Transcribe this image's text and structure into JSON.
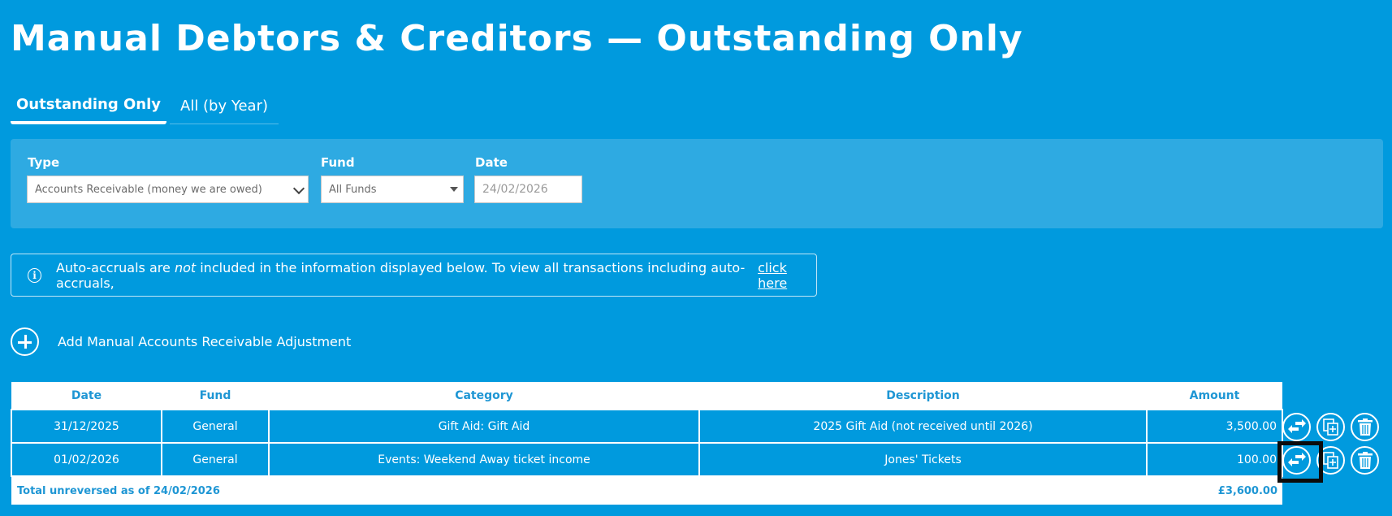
{
  "page": {
    "title": "Manual Debtors & Creditors — Outstanding Only"
  },
  "tabs": [
    {
      "label": "Outstanding Only",
      "active": true
    },
    {
      "label": "All (by Year)",
      "active": false
    }
  ],
  "filters": {
    "type_label": "Type",
    "type_value": "Accounts Receivable (money we are owed)",
    "fund_label": "Fund",
    "fund_value": "All Funds",
    "date_label": "Date",
    "date_value": "24/02/2026"
  },
  "info": {
    "text_before": "Auto-accruals are",
    "text_emphasis": "not",
    "text_after": "included in the information displayed below. To view all transactions including auto-accruals,",
    "link_text": "click here"
  },
  "add": {
    "label": "Add Manual Accounts Receivable Adjustment"
  },
  "table": {
    "headers": [
      "Date",
      "Fund",
      "Category",
      "Description",
      "Amount"
    ],
    "rows": [
      {
        "date": "31/12/2025",
        "fund": "General",
        "category": "Gift Aid: Gift Aid",
        "description": "2025 Gift Aid (not received until 2026)",
        "amount": "3,500.00"
      },
      {
        "date": "01/02/2026",
        "fund": "General",
        "category": "Events: Weekend Away ticket income",
        "description": "Jones' Tickets",
        "amount": "100.00"
      }
    ],
    "total_label": "Total unreversed as of 24/02/2026",
    "total_value": "£3,600.00"
  },
  "icons": {
    "reverse": "reverse-arrows-icon",
    "duplicate": "duplicate-icon",
    "delete": "trash-icon",
    "info": "info-icon",
    "add": "plus-circle-icon"
  },
  "colors": {
    "background": "#009ade",
    "panel": "#2eaae2",
    "header_text": "#1e96d4"
  }
}
